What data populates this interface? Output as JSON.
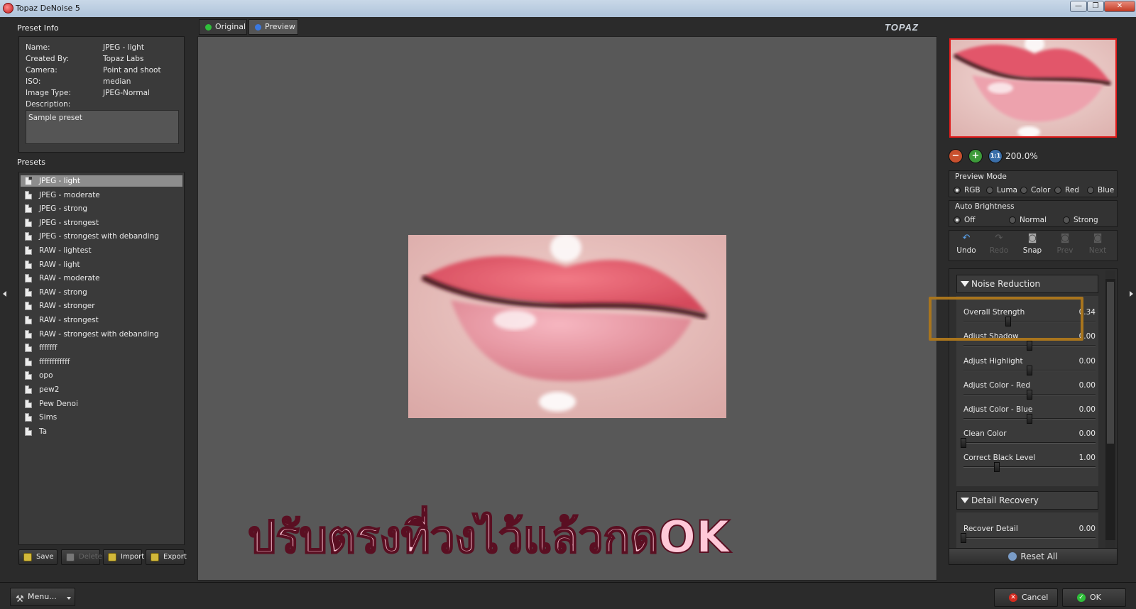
{
  "window": {
    "title": "Topaz DeNoise 5",
    "controls": [
      "—",
      "❐",
      "✕"
    ]
  },
  "preset_info": {
    "heading": "Preset Info",
    "rows": [
      {
        "key": "Name:",
        "value": "JPEG - light"
      },
      {
        "key": "Created By:",
        "value": "Topaz Labs"
      },
      {
        "key": "Camera:",
        "value": "Point and shoot"
      },
      {
        "key": "ISO:",
        "value": "median"
      },
      {
        "key": "Image Type:",
        "value": "JPEG-Normal"
      },
      {
        "key": "Description:",
        "value": ""
      }
    ],
    "description": "Sample preset"
  },
  "presets": {
    "heading": "Presets",
    "items": [
      "JPEG - light",
      "JPEG - moderate",
      "JPEG - strong",
      "JPEG - strongest",
      "JPEG - strongest with debanding",
      "RAW - lightest",
      "RAW - light",
      "RAW - moderate",
      "RAW - strong",
      "RAW - stronger",
      "RAW - strongest",
      "RAW - strongest with debanding",
      "fffffff",
      "ffffffffffff",
      "opo",
      "pew2",
      "Pew Denoi",
      "Sims",
      "Ta"
    ],
    "selected": "JPEG - light",
    "buttons": [
      {
        "label": "Save",
        "enabled": true
      },
      {
        "label": "Delete",
        "enabled": false
      },
      {
        "label": "Import",
        "enabled": true
      },
      {
        "label": "Export",
        "enabled": true
      }
    ]
  },
  "tabs": [
    {
      "label": "Original",
      "dot_color": "#2fbf3a",
      "active": false
    },
    {
      "label": "Preview",
      "dot_color": "#3a78e0",
      "active": true
    }
  ],
  "logo": "TOPAZ",
  "overlay_text": "ปรับตรงที่วงไว้แล้วกดOK",
  "zoom": {
    "value": "200.0%",
    "icons": [
      "zoom-out",
      "zoom-in",
      "zoom-1to1"
    ]
  },
  "preview_mode": {
    "title": "Preview Mode",
    "options": [
      "RGB",
      "Luma",
      "Color",
      "Red",
      "Blue"
    ],
    "selected": "RGB"
  },
  "auto_brightness": {
    "title": "Auto Brightness",
    "options": [
      "Off",
      "Normal",
      "Strong"
    ],
    "selected": "Off"
  },
  "history": [
    {
      "label": "Undo",
      "enabled": true
    },
    {
      "label": "Redo",
      "enabled": false
    },
    {
      "label": "Snap",
      "enabled": true
    },
    {
      "label": "Prev",
      "enabled": false
    },
    {
      "label": "Next",
      "enabled": false
    }
  ],
  "noise_reduction": {
    "title": "Noise Reduction",
    "sliders": [
      {
        "name": "Overall Strength",
        "value": "0.34",
        "level": 0.34
      },
      {
        "name": "Adjust Shadow",
        "value": "0.00",
        "level": 0.5
      },
      {
        "name": "Adjust Highlight",
        "value": "0.00",
        "level": 0.5
      },
      {
        "name": "Adjust Color - Red",
        "value": "0.00",
        "level": 0.5
      },
      {
        "name": "Adjust Color - Blue",
        "value": "0.00",
        "level": 0.5
      },
      {
        "name": "Clean Color",
        "value": "0.00",
        "level": 0.0
      },
      {
        "name": "Correct Black Level",
        "value": "1.00",
        "level": 0.25
      }
    ]
  },
  "detail_recovery": {
    "title": "Detail Recovery",
    "sliders": [
      {
        "name": "Recover Detail",
        "value": "0.00",
        "level": 0.0
      }
    ]
  },
  "reset_all": "Reset All",
  "bottom": {
    "menu": "Menu...",
    "cancel": "Cancel",
    "ok": "OK"
  },
  "colors": {
    "highlight": "#a9751d",
    "nav_border": "#e01a1a",
    "accent_red": "#d42a1e",
    "accent_green": "#2fbf3a"
  }
}
